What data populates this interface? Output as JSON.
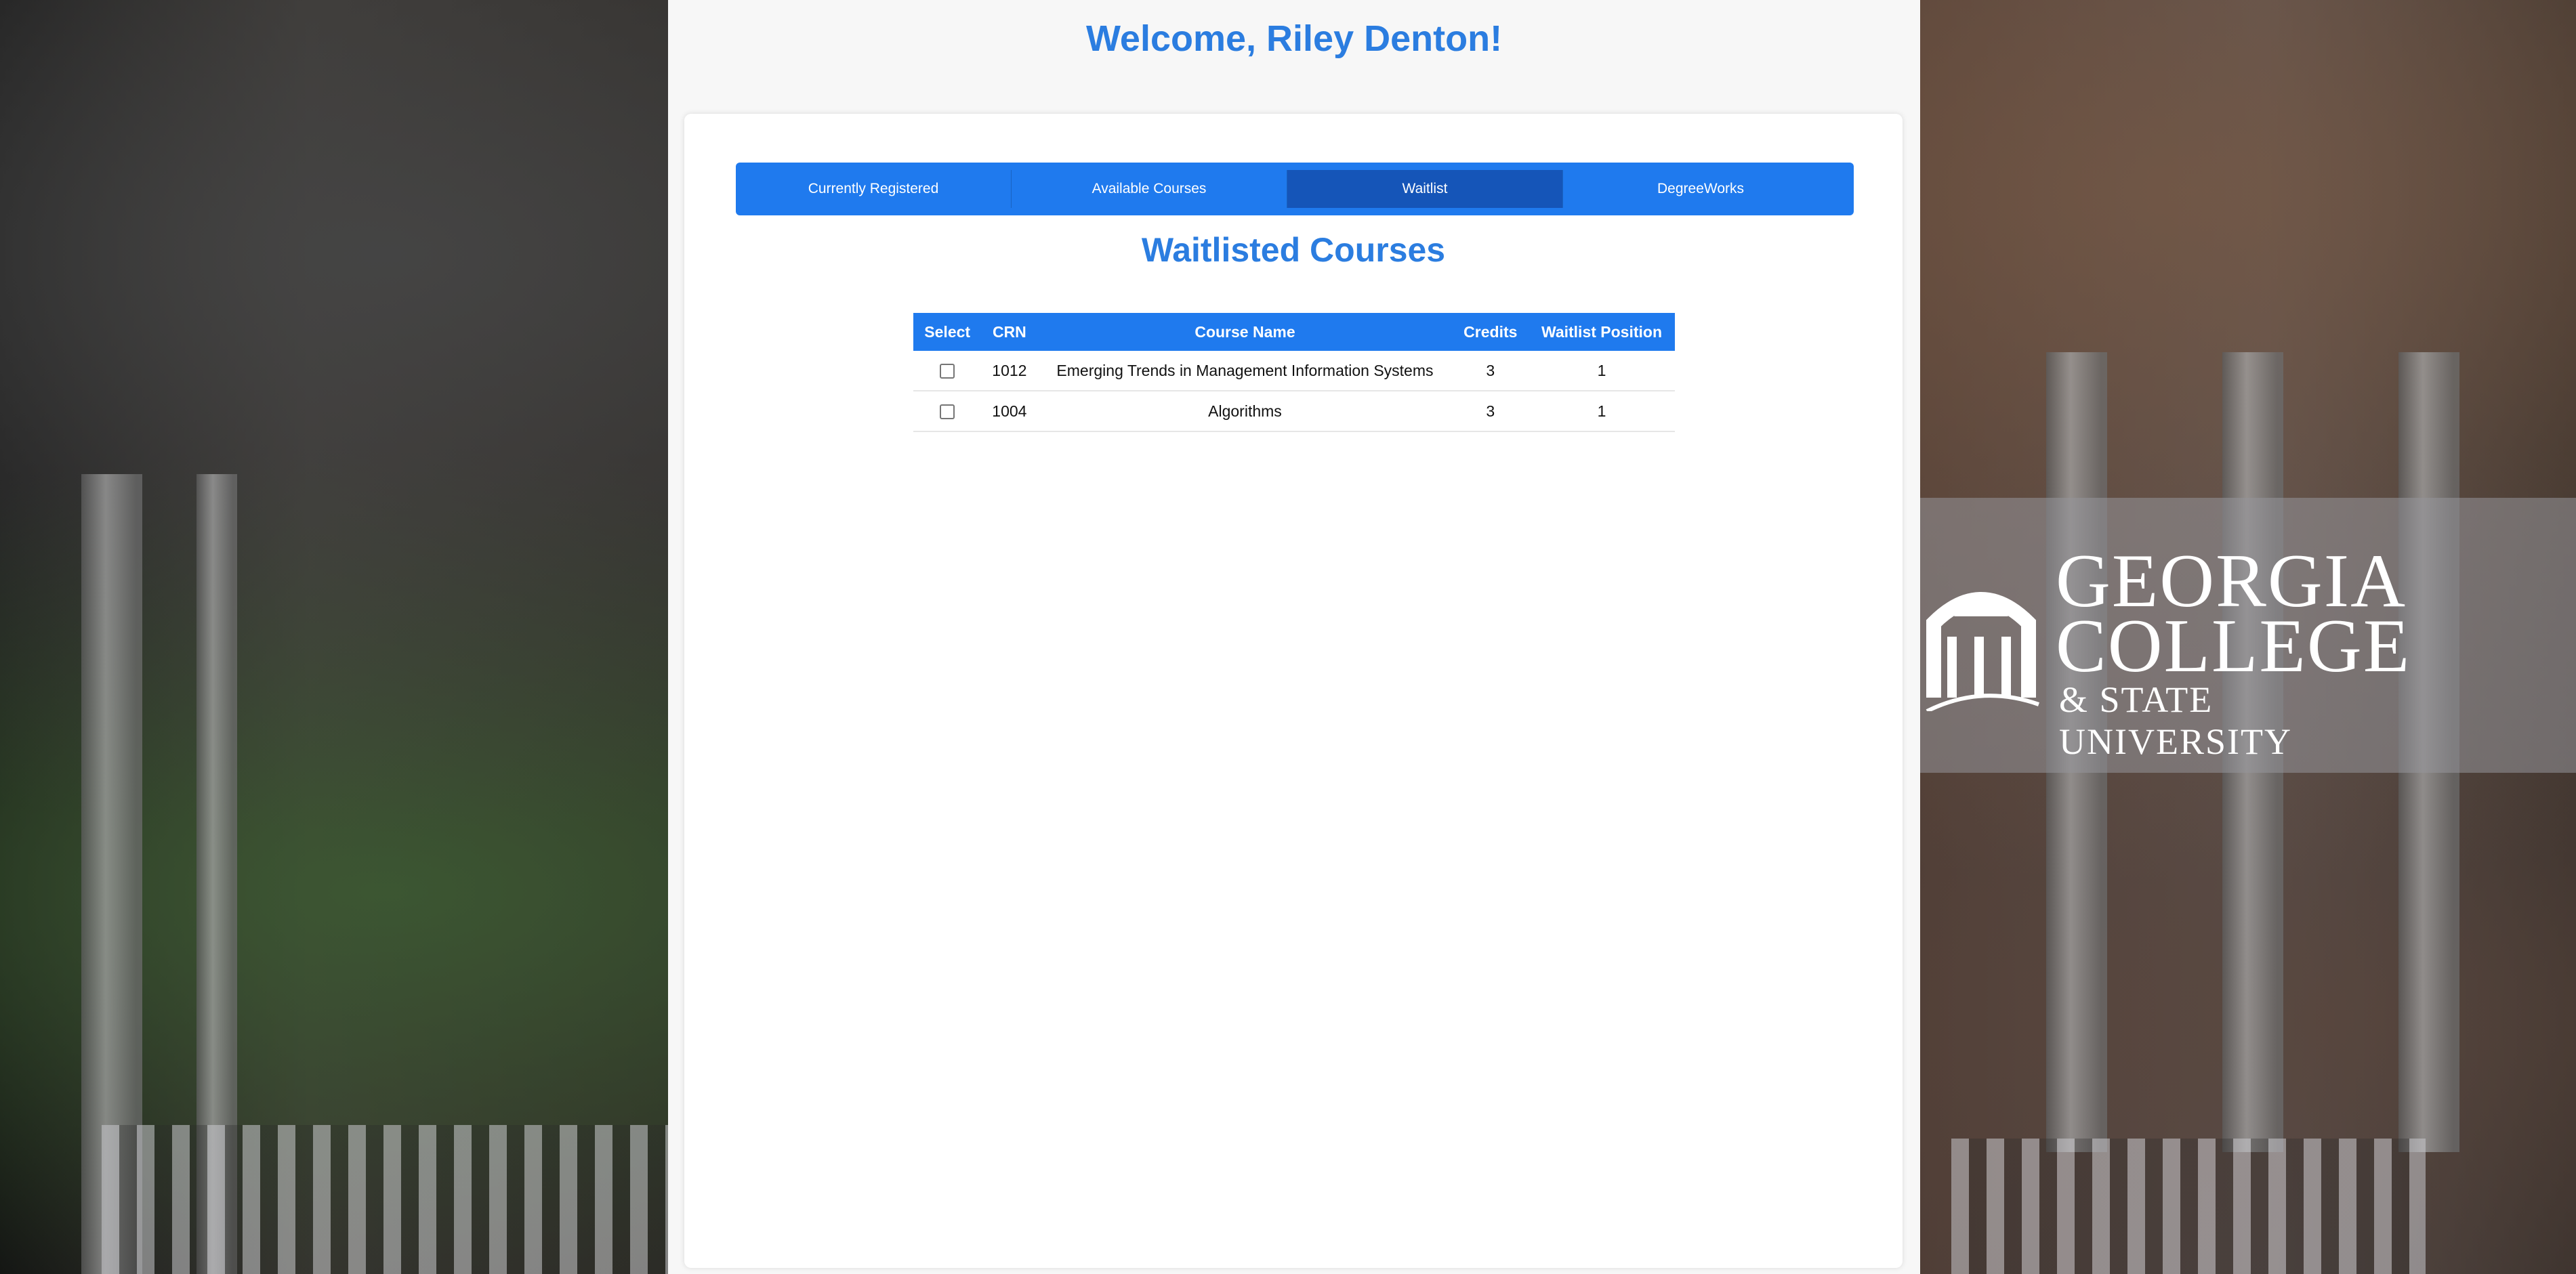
{
  "welcome": {
    "text": "Welcome, Riley Denton!"
  },
  "tabs": [
    {
      "label": "Currently Registered",
      "active": false
    },
    {
      "label": "Available Courses",
      "active": false
    },
    {
      "label": "Waitlist",
      "active": true
    },
    {
      "label": "DegreeWorks",
      "active": false
    }
  ],
  "section": {
    "title": "Waitlisted Courses"
  },
  "table": {
    "headers": [
      "Select",
      "CRN",
      "Course Name",
      "Credits",
      "Waitlist Position"
    ],
    "rows": [
      {
        "selected": false,
        "crn": "1012",
        "course_name": "Emerging Trends in Management Information Systems",
        "credits": "3",
        "waitlist_position": "1"
      },
      {
        "selected": false,
        "crn": "1004",
        "course_name": "Algorithms",
        "credits": "3",
        "waitlist_position": "1"
      }
    ]
  },
  "logo": {
    "line1": "GEORGIA",
    "line2": "COLLEGE",
    "line3": "& STATE UNIVERSITY"
  },
  "colors": {
    "accent": "#1f7aee",
    "accent_active": "#1555b8",
    "title": "#2b7de0"
  }
}
